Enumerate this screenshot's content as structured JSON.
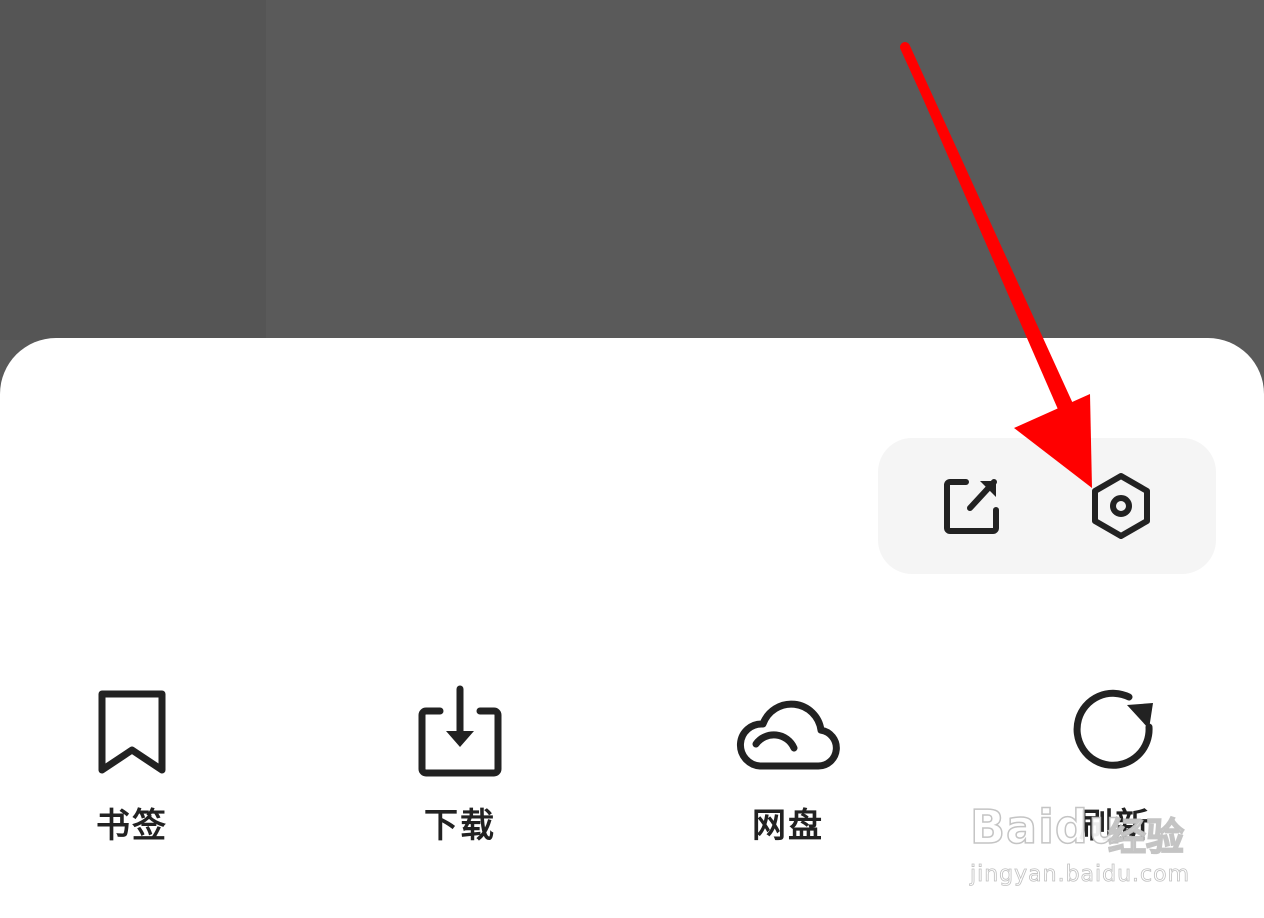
{
  "menu": {
    "items": [
      {
        "label": "书签",
        "icon": "bookmark-icon"
      },
      {
        "label": "下载",
        "icon": "download-icon"
      },
      {
        "label": "网盘",
        "icon": "cloud-icon"
      },
      {
        "label": "刷新",
        "icon": "refresh-icon"
      }
    ]
  },
  "quick_actions": {
    "items": [
      {
        "icon": "external-link-icon"
      },
      {
        "icon": "settings-icon"
      }
    ]
  },
  "annotation": {
    "arrow_color": "#ff0000"
  },
  "watermark": {
    "brand": "Baidu",
    "product": "经验",
    "url": "jingyan.baidu.com"
  },
  "colors": {
    "background_dim": "#5a5a5a",
    "sheet": "#ffffff",
    "pill": "#f5f5f5",
    "icon_stroke": "#222222"
  }
}
